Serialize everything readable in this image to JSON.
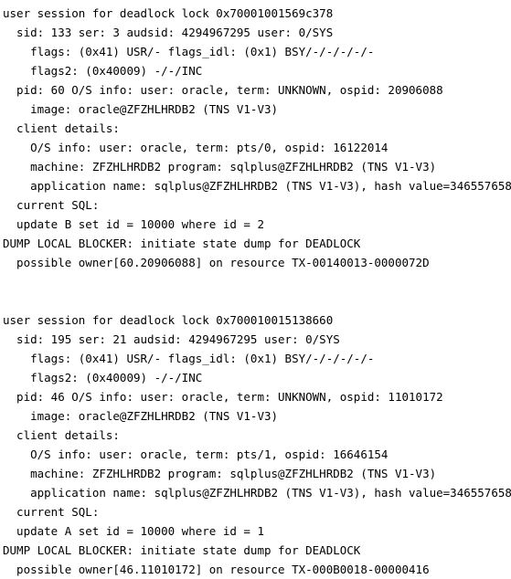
{
  "document": {
    "kind": "oracle-trace-file-text",
    "title": "user session for deadlock trace",
    "background_color": "#ffffff",
    "text_color": "#000000"
  },
  "trace": {
    "lines": [
      "user session for deadlock lock 0x70001001569c378",
      "  sid: 133 ser: 3 audsid: 4294967295 user: 0/SYS",
      "    flags: (0x41) USR/- flags_idl: (0x1) BSY/-/-/-/-/-",
      "    flags2: (0x40009) -/-/INC",
      "  pid: 60 O/S info: user: oracle, term: UNKNOWN, ospid: 20906088",
      "    image: oracle@ZFZHLHRDB2 (TNS V1-V3)",
      "  client details:",
      "    O/S info: user: oracle, term: pts/0, ospid: 16122014",
      "    machine: ZFZHLHRDB2 program: sqlplus@ZFZHLHRDB2 (TNS V1-V3)",
      "    application name: sqlplus@ZFZHLHRDB2 (TNS V1-V3), hash value=346557658",
      "  current SQL:",
      "  update B set id = 10000 where id = 2",
      "DUMP LOCAL BLOCKER: initiate state dump for DEADLOCK",
      "  possible owner[60.20906088] on resource TX-00140013-0000072D",
      "",
      "",
      "user session for deadlock lock 0x700010015138660",
      "  sid: 195 ser: 21 audsid: 4294967295 user: 0/SYS",
      "    flags: (0x41) USR/- flags_idl: (0x1) BSY/-/-/-/-/-",
      "    flags2: (0x40009) -/-/INC",
      "  pid: 46 O/S info: user: oracle, term: UNKNOWN, ospid: 11010172",
      "    image: oracle@ZFZHLHRDB2 (TNS V1-V3)",
      "  client details:",
      "    O/S info: user: oracle, term: pts/1, ospid: 16646154",
      "    machine: ZFZHLHRDB2 program: sqlplus@ZFZHLHRDB2 (TNS V1-V3)",
      "    application name: sqlplus@ZFZHLHRDB2 (TNS V1-V3), hash value=346557658",
      "  current SQL:",
      "  update A set id = 10000 where id = 1",
      "DUMP LOCAL BLOCKER: initiate state dump for DEADLOCK",
      "  possible owner[46.11010172] on resource TX-000B0018-00000416"
    ],
    "sessions": [
      {
        "header": "user session for deadlock lock 0x70001001569c378",
        "lock_address": "0x70001001569c378",
        "sid": "133",
        "ser": "3",
        "audsid": "4294967295",
        "user": "0/SYS",
        "flags": "(0x41) USR/- flags_idl: (0x1) BSY/-/-/-/-/-",
        "flags2": "(0x40009) -/-/INC",
        "pid": "60",
        "os_user": "oracle",
        "os_term": "UNKNOWN",
        "os_ospid": "20906088",
        "image": "oracle@ZFZHLHRDB2 (TNS V1-V3)",
        "client_os_user": "oracle",
        "client_term": "pts/0",
        "client_ospid": "16122014",
        "machine": "ZFZHLHRDB2",
        "program": "sqlplus@ZFZHLHRDB2 (TNS V1-V3)",
        "application_name": "sqlplus@ZFZHLHRDB2 (TNS V1-V3)",
        "hash_value": "346557658",
        "current_sql": "update B set id = 10000 where id = 2",
        "dump_message": "DUMP LOCAL BLOCKER: initiate state dump for DEADLOCK",
        "possible_owner": "60.20906088",
        "resource": "TX-00140013-0000072D"
      },
      {
        "header": "user session for deadlock lock 0x700010015138660",
        "lock_address": "0x700010015138660",
        "sid": "195",
        "ser": "21",
        "audsid": "4294967295",
        "user": "0/SYS",
        "flags": "(0x41) USR/- flags_idl: (0x1) BSY/-/-/-/-/-",
        "flags2": "(0x40009) -/-/INC",
        "pid": "46",
        "os_user": "oracle",
        "os_term": "UNKNOWN",
        "os_ospid": "11010172",
        "image": "oracle@ZFZHLHRDB2 (TNS V1-V3)",
        "client_os_user": "oracle",
        "client_term": "pts/1",
        "client_ospid": "16646154",
        "machine": "ZFZHLHRDB2",
        "program": "sqlplus@ZFZHLHRDB2 (TNS V1-V3)",
        "application_name": "sqlplus@ZFZHLHRDB2 (TNS V1-V3)",
        "hash_value": "346557658",
        "current_sql": "update A set id = 10000 where id = 1",
        "dump_message": "DUMP LOCAL BLOCKER: initiate state dump for DEADLOCK",
        "possible_owner": "46.11010172",
        "resource": "TX-000B0018-00000416"
      }
    ]
  }
}
